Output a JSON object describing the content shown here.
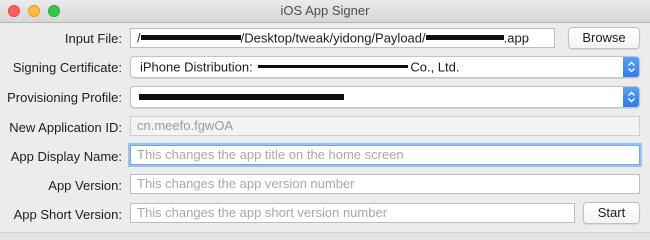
{
  "window": {
    "title": "iOS App Signer"
  },
  "labels": {
    "input_file": "Input File:",
    "signing_certificate": "Signing Certificate:",
    "provisioning_profile": "Provisioning Profile:",
    "new_app_id": "New Application ID:",
    "app_display_name": "App Display Name:",
    "app_version": "App Version:",
    "app_short_version": "App Short Version:"
  },
  "input_file": {
    "prefix": "/",
    "middle": "/Desktop/tweak/yidong/Payload/",
    "suffix": ".app"
  },
  "signing_certificate": {
    "prefix": "iPhone Distribution: ",
    "suffix": "Co., Ltd."
  },
  "new_app_id": {
    "value": "cn.meefo.fgwOA"
  },
  "app_display_name": {
    "placeholder": "This changes the app title on the home screen"
  },
  "app_version": {
    "placeholder": "This changes the app version number"
  },
  "app_short_version": {
    "placeholder": "This changes the app short version number"
  },
  "buttons": {
    "browse": "Browse",
    "start": "Start"
  }
}
